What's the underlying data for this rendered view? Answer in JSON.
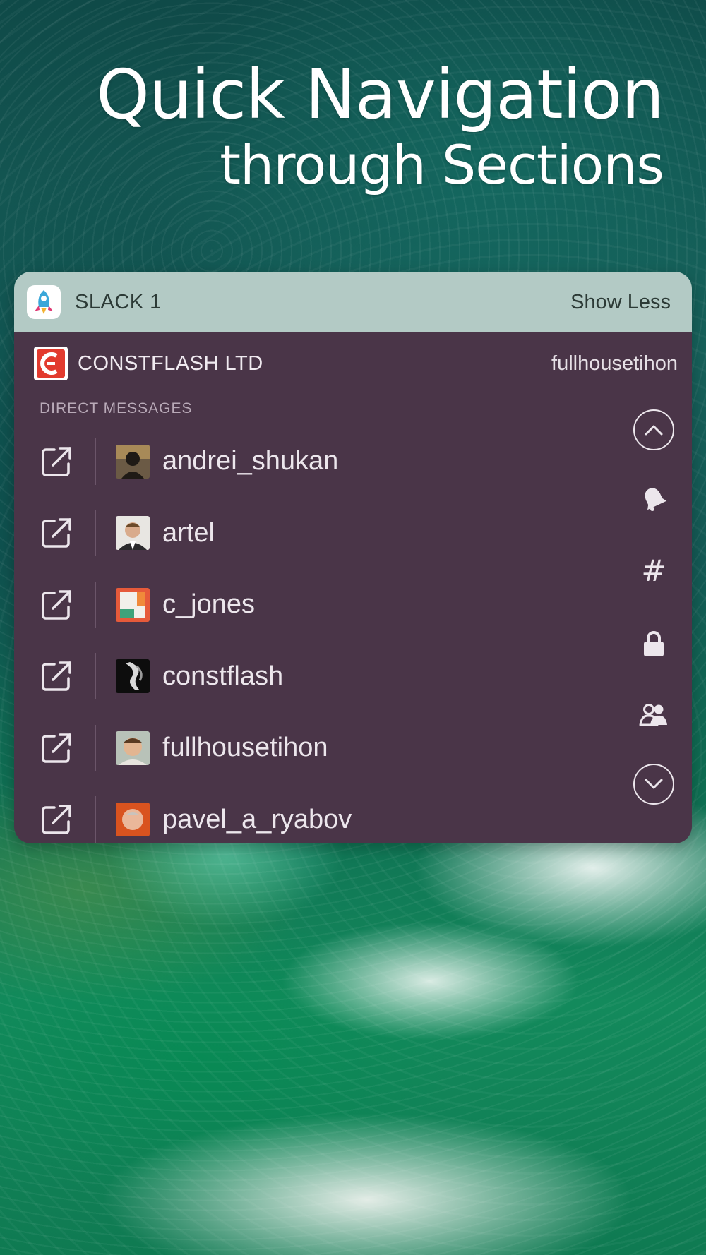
{
  "headline": {
    "line1": "Quick Navigation",
    "line2": "through Sections"
  },
  "widget": {
    "app_name": "SLACK 1",
    "show_less_label": "Show Less",
    "team": {
      "name": "CONSTFLASH LTD",
      "user": "fullhousetihon"
    },
    "section_label": "DIRECT MESSAGES",
    "direct_messages": [
      {
        "name": "andrei_shukan"
      },
      {
        "name": "artel"
      },
      {
        "name": "c_jones"
      },
      {
        "name": "constflash"
      },
      {
        "name": "fullhousetihon"
      },
      {
        "name": "pavel_a_ryabov"
      }
    ],
    "nav_icons": [
      "chevron-up-icon",
      "bell-icon",
      "hash-icon",
      "lock-icon",
      "users-icon",
      "chevron-down-icon"
    ],
    "colors": {
      "header_bg": "#b3cac5",
      "body_bg": "#4a3548",
      "text": "#ece6ec"
    }
  },
  "nav": {
    "hash_symbol": "#"
  }
}
